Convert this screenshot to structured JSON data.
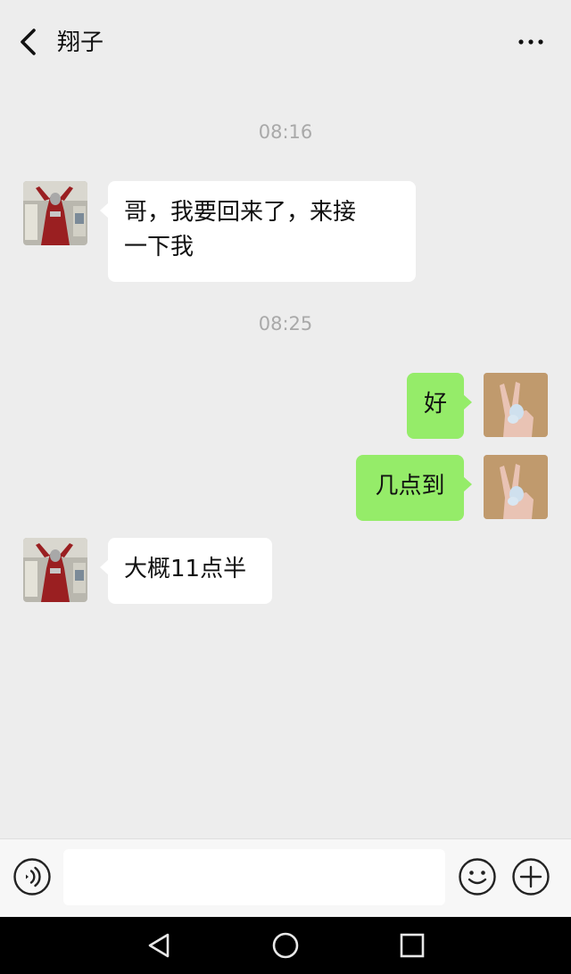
{
  "header": {
    "title": "翔子"
  },
  "icons": {
    "back": "chevron-left-icon",
    "more": "more-dots-icon",
    "voice": "voice-icon",
    "emoji": "smile-icon",
    "plus": "plus-icon"
  },
  "colors": {
    "background": "#ededed",
    "outgoing_bubble": "#95ec69",
    "incoming_bubble": "#ffffff",
    "timestamp": "#a9a9a9"
  },
  "messages": {
    "time_1": "08:16",
    "msg_1_line_1": "哥，我要回来了，来接",
    "msg_1_line_2": "一下我",
    "time_2": "08:25",
    "msg_2": "好",
    "msg_3": "几点到",
    "msg_4": "大概11点半"
  },
  "input": {
    "value": ""
  }
}
